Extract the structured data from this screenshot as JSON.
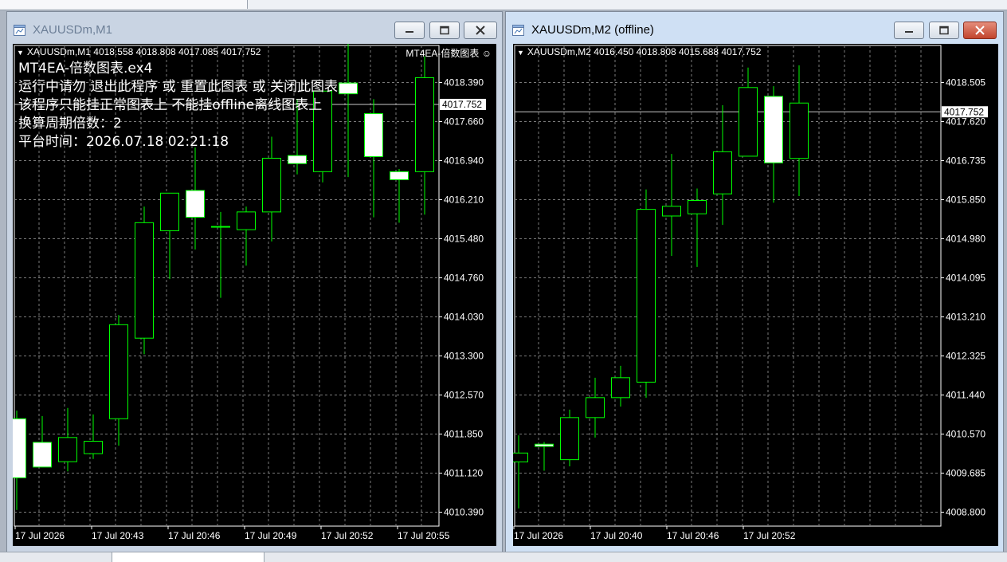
{
  "colors": {
    "up": "#00ff00",
    "bull_body": "#000000",
    "bear_body": "#ffffff",
    "grid": "#7a7a7a",
    "text": "#ffffff",
    "background": "#000000"
  },
  "charts": [
    {
      "window_title": "XAUUSDm,M1",
      "info": "XAUUSDm,M1  4018.558 4018.808 4017.085 4017.752",
      "ea_label": "MT4EA-倍数图表",
      "smile_icon": "smiley-face-icon",
      "comment": [
        "MT4EA-倍数图表.ex4",
        "运行中请勿 退出此程序 或 重置此图表 或 关闭此图表",
        "该程序只能挂正常图表上 不能挂offline离线图表上",
        "换算周期倍数：2",
        "平台时间：2026.07.18 02:21:18"
      ],
      "price_labels": [
        "4018.390",
        "4017.660",
        "4016.940",
        "4016.210",
        "4015.480",
        "4014.760",
        "4014.030",
        "4013.300",
        "4012.570",
        "4011.850",
        "4011.120",
        "4010.390"
      ],
      "current_price": "4017.752",
      "time_labels": [
        "17 Jul 2026",
        "17 Jul 20:43",
        "17 Jul 20:46",
        "17 Jul 20:49",
        "17 Jul 20:52",
        "17 Jul 20:55"
      ],
      "chart_data": {
        "type": "candlestick",
        "ylim": [
          4009.9,
          4018.85
        ],
        "candles": [
          {
            "o": 4011.9,
            "h": 4012.05,
            "l": 4010.2,
            "c": 4010.8
          },
          {
            "o": 4011.46,
            "h": 4011.95,
            "l": 4011.0,
            "c": 4011.0
          },
          {
            "o": 4011.1,
            "h": 4012.1,
            "l": 4010.92,
            "c": 4011.55
          },
          {
            "o": 4011.25,
            "h": 4011.98,
            "l": 4011.15,
            "c": 4011.48
          },
          {
            "o": 4011.9,
            "h": 4013.83,
            "l": 4011.4,
            "c": 4013.65
          },
          {
            "o": 4013.4,
            "h": 4015.85,
            "l": 4013.1,
            "c": 4015.55
          },
          {
            "o": 4015.4,
            "h": 4016.05,
            "l": 4014.5,
            "c": 4016.1
          },
          {
            "o": 4016.15,
            "h": 4016.95,
            "l": 4015.05,
            "c": 4015.65
          },
          {
            "o": 4015.48,
            "h": 4015.75,
            "l": 4014.15,
            "c": 4015.48
          },
          {
            "o": 4015.42,
            "h": 4015.85,
            "l": 4014.75,
            "c": 4015.75
          },
          {
            "o": 4015.75,
            "h": 4017.15,
            "l": 4015.2,
            "c": 4016.75
          },
          {
            "o": 4016.8,
            "h": 4017.85,
            "l": 4016.45,
            "c": 4016.65
          },
          {
            "o": 4016.5,
            "h": 4017.95,
            "l": 4016.3,
            "c": 4018.0
          },
          {
            "o": 4018.15,
            "h": 4018.9,
            "l": 4016.4,
            "c": 4017.95
          },
          {
            "o": 4017.58,
            "h": 4017.85,
            "l": 4015.65,
            "c": 4016.78
          },
          {
            "o": 4016.5,
            "h": 4016.55,
            "l": 4015.55,
            "c": 4016.35
          },
          {
            "o": 4016.5,
            "h": 4018.65,
            "l": 4015.7,
            "c": 4018.25
          }
        ]
      }
    },
    {
      "window_title": "XAUUSDm,M2 (offline)",
      "info": "XAUUSDm,M2  4016.450 4018.808 4015.688 4017.752",
      "price_labels": [
        "4018.505",
        "4017.620",
        "4016.735",
        "4015.850",
        "4014.980",
        "4014.095",
        "4013.210",
        "4012.325",
        "4011.440",
        "4010.570",
        "4009.685",
        "4008.800"
      ],
      "current_price": "4017.752",
      "time_labels": [
        "17 Jul 2026",
        "17 Jul 20:40",
        "17 Jul 20:46",
        "17 Jul 20:52"
      ],
      "chart_data": {
        "type": "candlestick",
        "ylim": [
          4008.4,
          4019.25
        ],
        "candles": [
          {
            "o": 4009.85,
            "h": 4010.45,
            "l": 4008.8,
            "c": 4010.05
          },
          {
            "o": 4010.25,
            "h": 4010.3,
            "l": 4009.65,
            "c": 4010.2
          },
          {
            "o": 4009.9,
            "h": 4011.03,
            "l": 4009.75,
            "c": 4010.85
          },
          {
            "o": 4010.85,
            "h": 4011.75,
            "l": 4010.4,
            "c": 4011.3
          },
          {
            "o": 4011.3,
            "h": 4012.02,
            "l": 4011.1,
            "c": 4011.75
          },
          {
            "o": 4011.65,
            "h": 4016.0,
            "l": 4011.3,
            "c": 4015.55
          },
          {
            "o": 4015.4,
            "h": 4016.8,
            "l": 4014.5,
            "c": 4015.62
          },
          {
            "o": 4015.45,
            "h": 4016.02,
            "l": 4014.25,
            "c": 4015.75
          },
          {
            "o": 4015.9,
            "h": 4017.9,
            "l": 4015.2,
            "c": 4016.85
          },
          {
            "o": 4016.75,
            "h": 4018.75,
            "l": 4016.75,
            "c": 4018.3
          },
          {
            "o": 4018.1,
            "h": 4018.33,
            "l": 4015.7,
            "c": 4016.6
          },
          {
            "o": 4016.7,
            "h": 4018.8,
            "l": 4015.85,
            "c": 4017.95
          }
        ]
      }
    }
  ]
}
